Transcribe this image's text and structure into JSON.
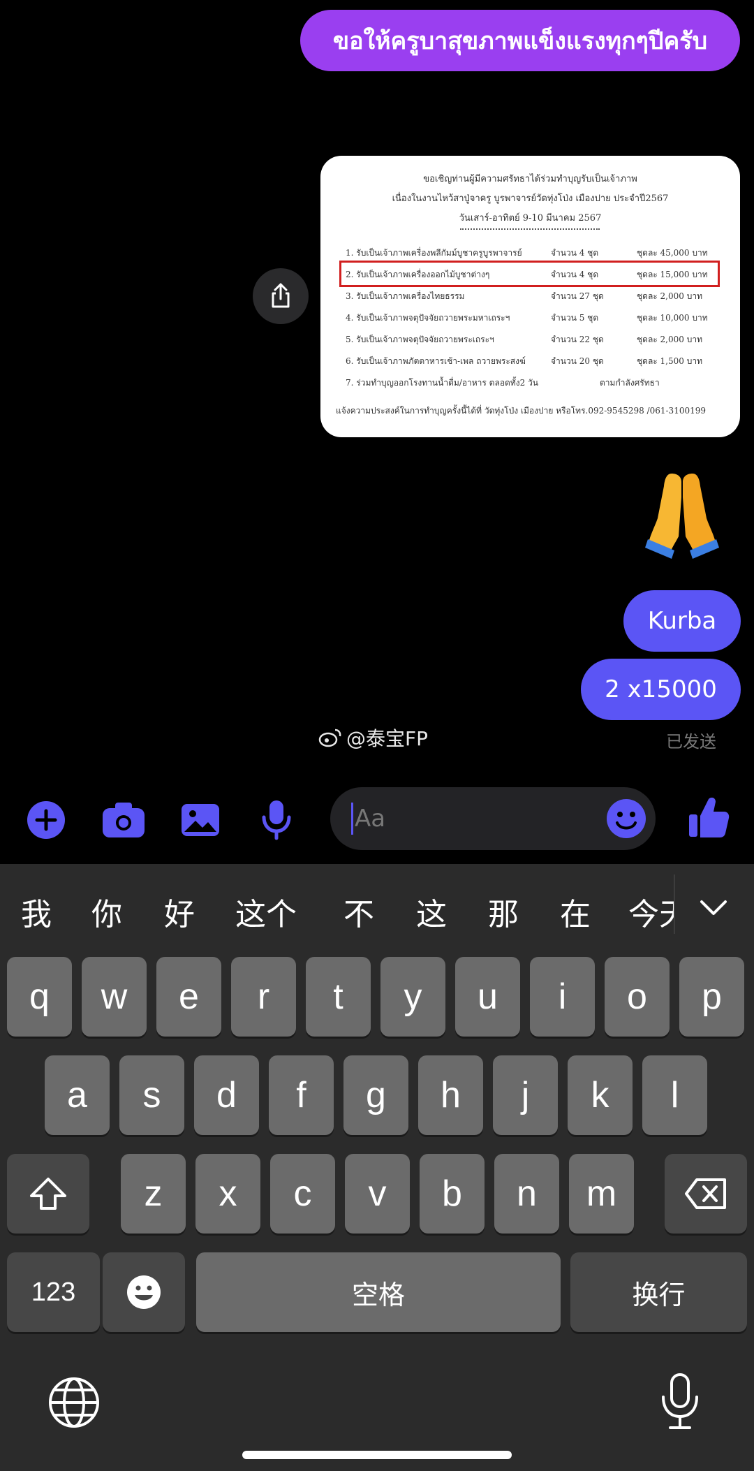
{
  "messages": {
    "thai_wish": "ขอให้ครูบาสุขภาพแข็งแรงทุกๆปีครับ",
    "kurba": "Kurba",
    "amount": "2 x15000",
    "status": "已发送"
  },
  "poster": {
    "header_line1": "ขอเชิญท่านผู้มีความศรัทธาได้ร่วมทำบุญรับเป็นเจ้าภาพ",
    "header_line2": "เนื่องในงานไหว้สาปู่จาครู บูรพาจารย์วัดทุ่งโป่ง เมืองปาย ประจำปี2567",
    "header_line3": "วันเสาร์-อาทิตย์ 9-10 มีนาคม 2567",
    "items": [
      {
        "name": "1. รับเป็นเจ้าภาพเครื่องพลีกัมม์บูชาครูบูรพาจารย์",
        "qty": "จำนวน 4 ชุด",
        "price": "ชุดละ 45,000 บาท"
      },
      {
        "name": "2. รับเป็นเจ้าภาพเครื่องออกไม้บูชาต่างๆ",
        "qty": "จำนวน 4 ชุด",
        "price": "ชุดละ 15,000 บาท"
      },
      {
        "name": "3. รับเป็นเจ้าภาพเครื่องไทยธรรม",
        "qty": "จำนวน 27 ชุด",
        "price": "ชุดละ 2,000 บาท"
      },
      {
        "name": "4. รับเป็นเจ้าภาพจตุปัจจัยถวายพระมหาเถระฯ",
        "qty": "จำนวน 5 ชุด",
        "price": "ชุดละ 10,000 บาท"
      },
      {
        "name": "5. รับเป็นเจ้าภาพจตุปัจจัยถวายพระเถระฯ",
        "qty": "จำนวน 22 ชุด",
        "price": "ชุดละ 2,000 บาท"
      },
      {
        "name": "6. รับเป็นเจ้าภาพภัตตาหารเช้า-เพล ถวายพระสงฆ์",
        "qty": "จำนวน 20 ชุด",
        "price": "ชุดละ 1,500 บาท"
      },
      {
        "name": "7. ร่วมทำบุญออกโรงทานน้ำดื่ม/อาหาร ตลอดทั้ง2 วัน",
        "qty": "",
        "price": "ตามกำลังศรัทธา"
      }
    ],
    "footer": "แจ้งความประสงค์ในการทำบุญครั้งนี้ได้ที่ วัดทุ่งโป่ง เมืองปาย หรือโทร.092-9545298 /061-3100199"
  },
  "watermark": "@泰宝FP",
  "composer": {
    "placeholder": "Aa"
  },
  "keyboard": {
    "suggestions": [
      "我",
      "你",
      "好",
      "这个",
      "不",
      "这",
      "那",
      "在",
      "今天"
    ],
    "row1": [
      "q",
      "w",
      "e",
      "r",
      "t",
      "y",
      "u",
      "i",
      "o",
      "p"
    ],
    "row2": [
      "a",
      "s",
      "d",
      "f",
      "g",
      "h",
      "j",
      "k",
      "l"
    ],
    "row3": [
      "z",
      "x",
      "c",
      "v",
      "b",
      "n",
      "m"
    ],
    "numbers_label": "123",
    "space_label": "空格",
    "return_label": "换行"
  },
  "colors": {
    "accent": "#5b55f5",
    "wish_bubble": "#9a3ff0",
    "highlight_box": "#d11f1f"
  },
  "icons": [
    "share-icon",
    "plus-icon",
    "camera-icon",
    "image-icon",
    "mic-icon",
    "emoji-icon",
    "thumbs-up-icon",
    "chevron-down-icon",
    "shift-icon",
    "backspace-icon",
    "globe-icon"
  ]
}
